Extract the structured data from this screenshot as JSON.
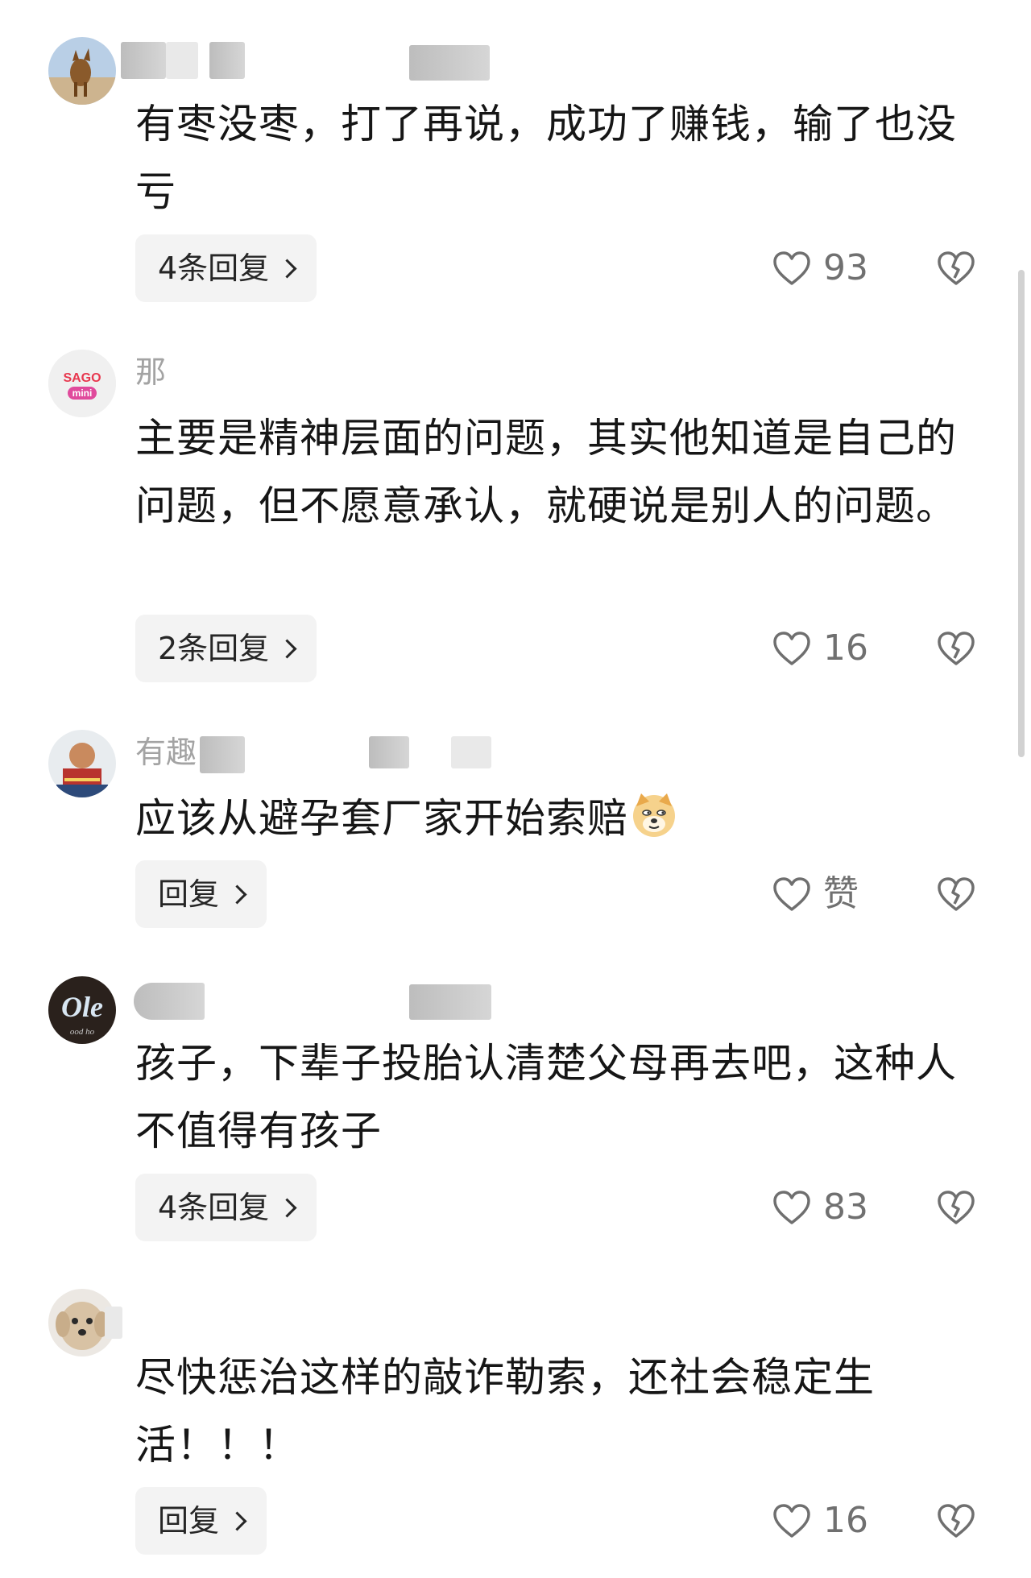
{
  "comments": [
    {
      "username": "",
      "text": "有枣没枣，打了再说，成功了赚钱，输了也没亏",
      "reply_label": "4条回复",
      "like_count": "93"
    },
    {
      "username": "那",
      "avatar_text": "SAGO mini",
      "text": "主要是精神层面的问题，其实他知道是自己的问题，但不愿意承认，就硬说是别人的问题。",
      "reply_label": "2条回复",
      "like_count": "16"
    },
    {
      "username": "有趣",
      "text": "应该从避孕套厂家开始索赔",
      "reply_label": "回复",
      "like_count": "赞"
    },
    {
      "username": "",
      "avatar_text": "Ole",
      "text": "孩子，下辈子投胎认清楚父母再去吧，这种人不值得有孩子",
      "reply_label": "4条回复",
      "like_count": "83"
    },
    {
      "username": "",
      "text": "尽快惩治这样的敲诈勒索，还社会稳定生活！！！",
      "reply_label": "回复",
      "like_count": "16"
    }
  ],
  "icons": {
    "like": "heart-icon",
    "dislike": "broken-heart-icon",
    "reply_arrow": "chevron-right-icon",
    "emoji": "doge-emoji-icon"
  },
  "colors": {
    "text": "#161616",
    "muted": "#707070",
    "username": "#a3a3a3",
    "reply_bg": "#f3f3f3",
    "sago_red": "#e8384f",
    "sago_pink": "#e04a9c"
  }
}
